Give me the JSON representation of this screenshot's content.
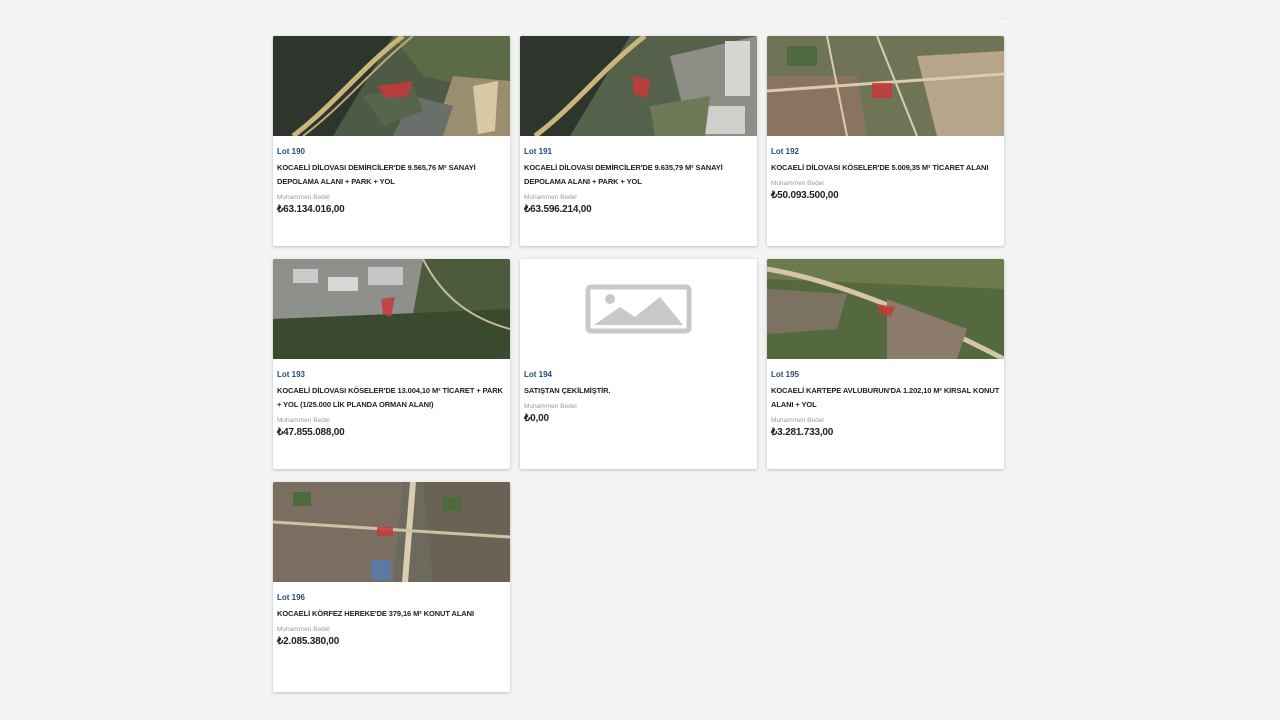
{
  "price_label": "Muhammen Bedel",
  "lots": [
    {
      "lot": "Lot 190",
      "title": "KOCAELİ DİLOVASI DEMİRCİLER'DE 9.565,76 M² SANAYİ DEPOLAMA ALANI + PARK + YOL",
      "price": "₺63.134.016,00",
      "image": "satellite-map"
    },
    {
      "lot": "Lot 191",
      "title": "KOCAELİ DİLOVASI DEMİRCİLER'DE 9.635,79 M² SANAYİ DEPOLAMA ALANI + PARK + YOL",
      "price": "₺63.596.214,00",
      "image": "satellite-map"
    },
    {
      "lot": "Lot 192",
      "title": "KOCAELİ DİLOVASI KÖSELER'DE 5.009,35 M² TİCARET ALANI",
      "price": "₺50.093.500,00",
      "image": "satellite-map"
    },
    {
      "lot": "Lot 193",
      "title": "KOCAELİ DİLOVASI KÖSELER'DE 13.004,10 M² TİCARET + PARK + YOL (1/25.000 LİK PLANDA ORMAN ALANI)",
      "price": "₺47.855.088,00",
      "image": "satellite-map"
    },
    {
      "lot": "Lot 194",
      "title": "SATIŞTAN ÇEKİLMİŞTİR.",
      "price": "₺0,00",
      "image": "image-placeholder-icon"
    },
    {
      "lot": "Lot 195",
      "title": "KOCAELİ KARTEPE AVLUBURUN'DA 1.202,10 M² KIRSAL KONUT ALANI + YOL",
      "price": "₺3.281.733,00",
      "image": "satellite-map"
    },
    {
      "lot": "Lot 196",
      "title": "KOCAELİ KÖRFEZ HEREKE'DE 379,16 M² KONUT ALANI",
      "price": "₺2.085.380,00",
      "image": "satellite-map"
    }
  ]
}
